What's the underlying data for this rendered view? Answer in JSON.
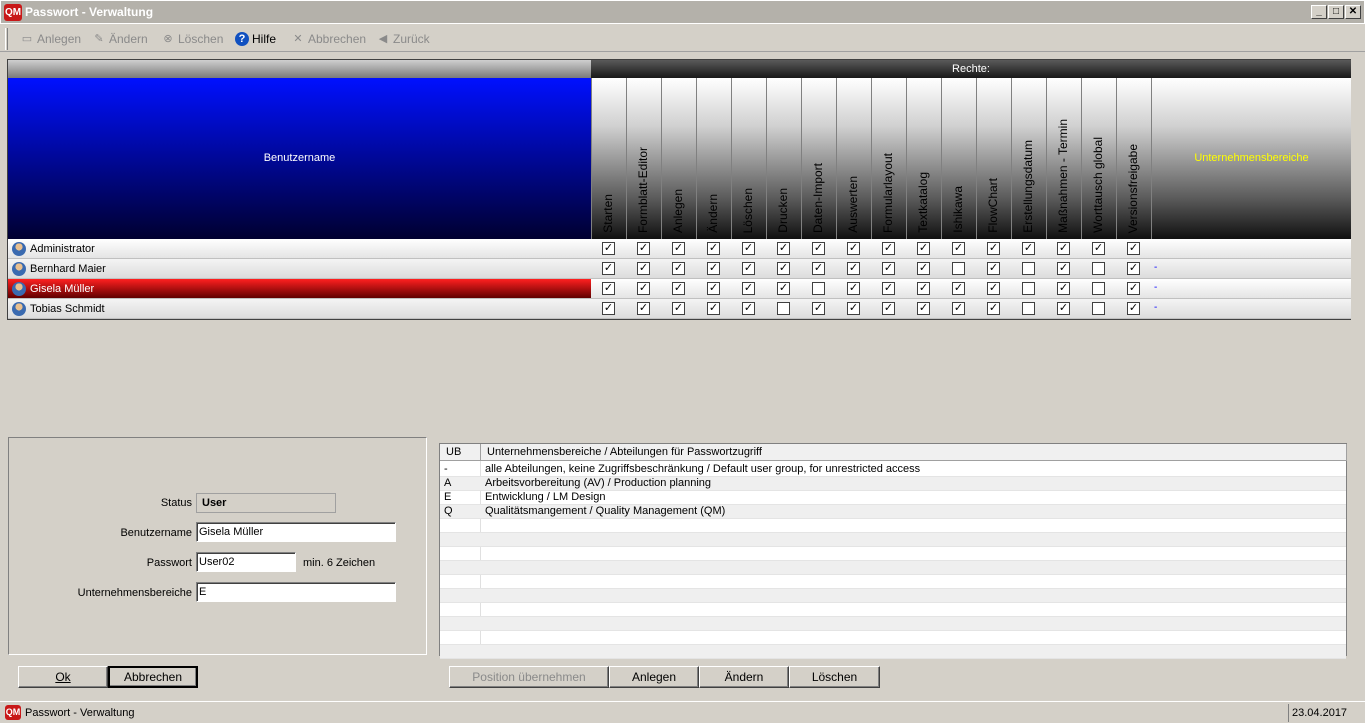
{
  "window": {
    "title": "Passwort - Verwaltung",
    "logo": "QM",
    "min_icon": "minimize-icon",
    "max_icon": "maximize-icon",
    "close_icon": "close-icon"
  },
  "toolbar": {
    "anlegen": "Anlegen",
    "aendern": "Ändern",
    "loeschen": "Löschen",
    "hilfe": "Hilfe",
    "abbrechen": "Abbrechen",
    "zurueck": "Zurück"
  },
  "grid": {
    "rights_header": "Rechte:",
    "user_header": "Benutzername",
    "ub_header": "Unternehmensbereiche",
    "columns": [
      "Starten",
      "Formblatt-Editor",
      "Anlegen",
      "Ändern",
      "Löschen",
      "Drucken",
      "Daten-Import",
      "Auswerten",
      "Formularlayout",
      "Textkatalog",
      "Ishikawa",
      "FlowChart",
      "Erstellungsdatum",
      "Maßnahmen - Termin",
      "Worttausch global",
      "Versionsfreigabe"
    ],
    "rows": [
      {
        "name": "Administrator",
        "checks": [
          1,
          1,
          1,
          1,
          1,
          1,
          1,
          1,
          1,
          1,
          1,
          1,
          1,
          1,
          1,
          1
        ],
        "ub": ""
      },
      {
        "name": "Bernhard Maier",
        "checks": [
          1,
          1,
          1,
          1,
          1,
          1,
          1,
          1,
          1,
          1,
          0,
          1,
          0,
          1,
          0,
          1
        ],
        "ub": "-"
      },
      {
        "name": "Gisela Müller",
        "checks": [
          1,
          1,
          1,
          1,
          1,
          1,
          0,
          1,
          1,
          1,
          1,
          1,
          0,
          1,
          0,
          1
        ],
        "ub": "-"
      },
      {
        "name": "Tobias Schmidt",
        "checks": [
          1,
          1,
          1,
          1,
          1,
          0,
          1,
          1,
          1,
          1,
          1,
          1,
          0,
          1,
          0,
          1
        ],
        "ub": "-"
      }
    ],
    "selected_row": 2,
    "header_color": "#0010ff",
    "selected_color": "#cc0000",
    "ub_header_color": "#ffff00"
  },
  "form": {
    "status_label": "Status",
    "status_value": "User",
    "username_label": "Benutzername",
    "username_value": "Gisela Müller",
    "password_label": "Passwort",
    "password_value": "User02",
    "password_hint": "min. 6 Zeichen",
    "ub_label": "Unternehmensbereiche",
    "ub_value": "E"
  },
  "ub_list": {
    "col_ub": "UB",
    "col_desc": "Unternehmensbereiche / Abteilungen für Passwortzugriff",
    "items": [
      {
        "ub": "-",
        "desc": "alle Abteilungen, keine Zugriffsbeschränkung / Default user group, for unrestricted access"
      },
      {
        "ub": "A",
        "desc": "Arbeitsvorbereitung (AV) / Production planning"
      },
      {
        "ub": "E",
        "desc": "Entwicklung / LM Design"
      },
      {
        "ub": "Q",
        "desc": "Qualitätsmangement  / Quality Management (QM)"
      }
    ]
  },
  "buttons": {
    "ok": "Ok",
    "abbrechen": "Abbrechen",
    "position": "Position übernehmen",
    "anlegen": "Anlegen",
    "aendern": "Ändern",
    "loeschen": "Löschen"
  },
  "statusbar": {
    "title": "Passwort - Verwaltung",
    "date": "23.04.2017",
    "logo": "QM"
  }
}
